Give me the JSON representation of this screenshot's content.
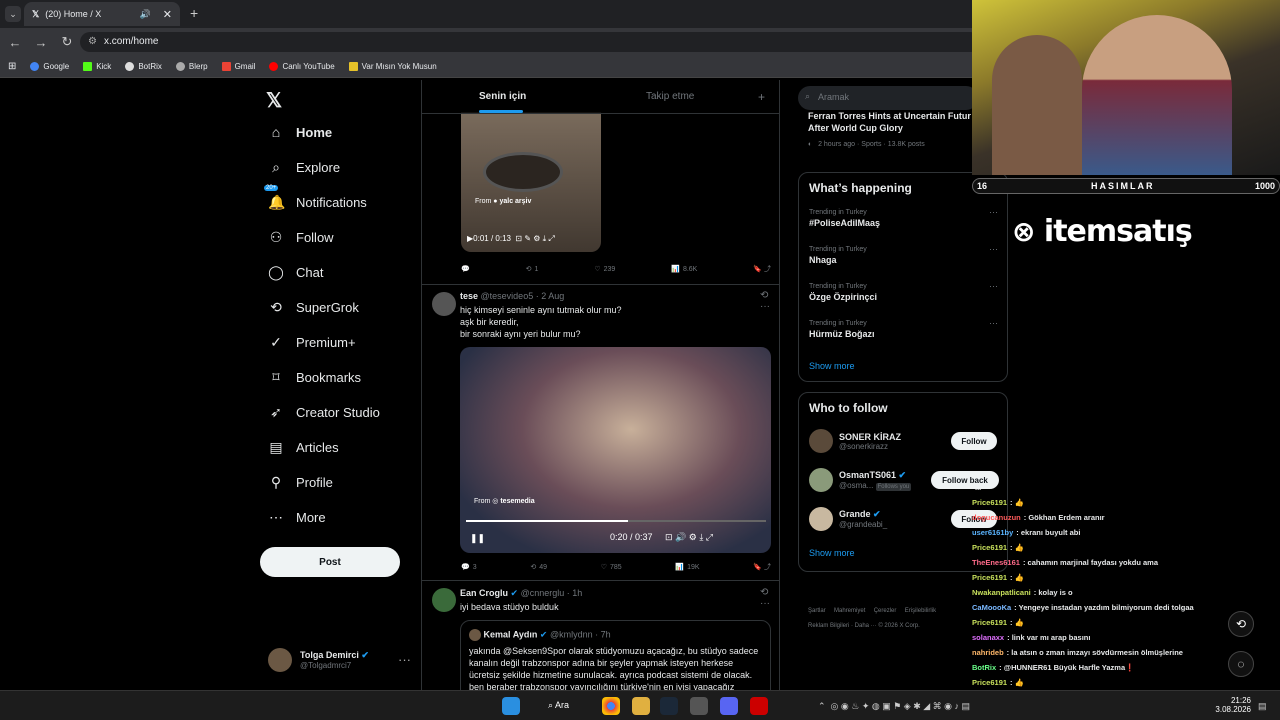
{
  "browser": {
    "tab_title": "(20) Home / X",
    "url": "x.com/home",
    "bookmarks": [
      "Google",
      "Kick",
      "BotRix",
      "Blerp",
      "Gmail",
      "Canlı YouTube",
      "Var Mısın Yok Musun"
    ]
  },
  "sidebar": {
    "nav": [
      {
        "label": "Home",
        "icon": "home-icon"
      },
      {
        "label": "Explore",
        "icon": "search-icon"
      },
      {
        "label": "Notifications",
        "icon": "bell-icon",
        "badge": "20+"
      },
      {
        "label": "Follow",
        "icon": "person-plus-icon"
      },
      {
        "label": "Chat",
        "icon": "chat-icon"
      },
      {
        "label": "SuperGrok",
        "icon": "grok-icon"
      },
      {
        "label": "Premium+",
        "icon": "verified-icon"
      },
      {
        "label": "Bookmarks",
        "icon": "bookmark-icon"
      },
      {
        "label": "Creator Studio",
        "icon": "rocket-icon"
      },
      {
        "label": "Articles",
        "icon": "article-icon"
      },
      {
        "label": "Profile",
        "icon": "profile-icon"
      },
      {
        "label": "More",
        "icon": "more-circle-icon"
      }
    ],
    "post_label": "Post",
    "account": {
      "name": "Tolga Demirci",
      "handle": "@Tolgadmrci7"
    }
  },
  "feed": {
    "tabs": [
      "Senin için",
      "Takip etme"
    ],
    "post1": {
      "video_from": "From",
      "video_source": "yalc arşiv",
      "video_time": "0:01 / 0:13",
      "replies": "",
      "reposts": "1",
      "likes": "239",
      "views": "8.6K"
    },
    "post2": {
      "name": "tese",
      "handle": "@tesevideo5 · 2 Aug",
      "text": [
        "hiç kimseyi seninle aynı tutmak olur mu?",
        "aşk bir keredir,",
        "bir sonraki aynı yeri bulur mu?"
      ],
      "video_from": "From",
      "video_source": "tesemedia",
      "video_time": "0:20 / 0:37",
      "progress": 0.54,
      "replies": "3",
      "reposts": "49",
      "likes": "785",
      "views": "19K"
    },
    "post3": {
      "name": "Ean Croglu",
      "handle": "@cnnerglu · 1h",
      "text": "iyi bedava stüdyo bulduk",
      "quote_name": "Kemal Aydın",
      "quote_handle": "@kmlydnn · 7h",
      "quote_text": [
        "yakında @Seksen9Spor olarak stüdyomuzu açacağız, bu stüdyo sadece",
        "kanalın değil trabzonspor adına bir şeyler yapmak isteyen herkese",
        "ücretsiz şekilde hizmetine sunulacak. ayrıca podcast sistemi de olacak.",
        "ben beraber trabzonspor yayıncılığını türkiye'nin en iyisi yapacağız"
      ]
    }
  },
  "right": {
    "search_placeholder": "Aramak",
    "top_news": {
      "title_line1": "Ferran Torres Hints at Uncertain Futur",
      "title_line2": "After World Cup Glory",
      "meta": "2 hours ago · Sports · 13.8K posts"
    },
    "happening_title": "What’s happening",
    "trends": [
      {
        "context": "Trending in Turkey",
        "name": "#PoliseAdilMaaş"
      },
      {
        "context": "Trending in Turkey",
        "name": "Nhaga"
      },
      {
        "context": "Trending in Turkey",
        "name": "Özge Özpirinçci"
      },
      {
        "context": "Trending in Turkey",
        "name": "Hürmüz Boğazı"
      }
    ],
    "show_more": "Show more",
    "wtf_title": "Who to follow",
    "who": [
      {
        "name": "SONER KİRAZ",
        "handle": "@sonerkirazz",
        "btn": "Follow"
      },
      {
        "name": "OsmanTS061",
        "handle": "@osma...",
        "btn": "Follow back",
        "tag": "Follows you"
      },
      {
        "name": "Grande",
        "handle": "@grandeabi_",
        "btn": "Follow"
      }
    ],
    "footer1": [
      "Şartlar",
      "Mahremiyet",
      "Çerezler",
      "Erişilebilirlik"
    ],
    "footer2": "Reklam Bilgileri · Daha ··· © 2026 X Corp."
  },
  "stream": {
    "bar_left": "16",
    "bar_mid": "HASIMLAR",
    "bar_right": "1000",
    "brand": "itemsatış",
    "chat": [
      {
        "user": "",
        "msg": "...",
        "color": "#e7e9ea"
      },
      {
        "user": "Price6191",
        "msg": ": 👍",
        "color": "#c8e05c"
      },
      {
        "user": "dogucanuzun",
        "msg": ": Gökhan Erdem aranır",
        "color": "#ff5a5a"
      },
      {
        "user": "user6161by",
        "msg": ": ekranı buyult abi",
        "color": "#5ab4ff"
      },
      {
        "user": "Price6191",
        "msg": ": 👍",
        "color": "#c8e05c"
      },
      {
        "user": "TheEnes6161",
        "msg": ": cahamın marjinal faydası yokdu ama",
        "color": "#ff6b8a"
      },
      {
        "user": "Price6191",
        "msg": ": 👍",
        "color": "#c8e05c"
      },
      {
        "user": "Nwakanpatlicani",
        "msg": ": kolay is o",
        "color": "#c8e05c"
      },
      {
        "user": "CaMoooKa",
        "msg": ": Yengeye instadan yazdım bilmiyorum dedi tolgaa",
        "color": "#7ab8ff"
      },
      {
        "user": "Price6191",
        "msg": ": 👍",
        "color": "#c8e05c"
      },
      {
        "user": "solanaxx",
        "msg": ": link var mı arap basını",
        "color": "#e070ff"
      },
      {
        "user": "nahrideb",
        "msg": ": la atsın o zman imzayı sövdürmesin ölmüşlerine",
        "color": "#ffb86a"
      },
      {
        "user": "BotRix",
        "msg": ": @HUNNER61 Büyük Harfle Yazma❗",
        "color": "#6aff8a"
      },
      {
        "user": "Price6191",
        "msg": ": 👍",
        "color": "#c8e05c"
      },
      {
        "user": "Price6191",
        "msg": ": 👍",
        "color": "#c8e05c"
      }
    ]
  },
  "taskbar": {
    "search": "Ara",
    "time": "21:26",
    "date": "3.08.2026"
  }
}
